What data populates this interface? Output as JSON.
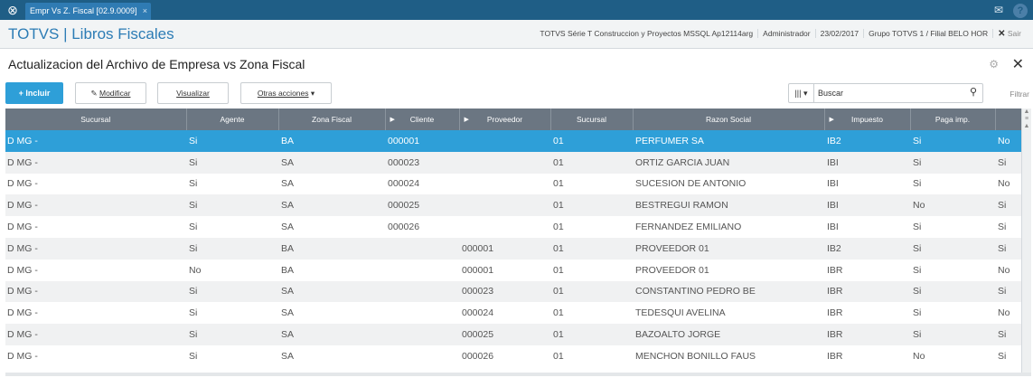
{
  "window": {
    "tab_label": "Empr Vs Z. Fiscal [02.9.0009]",
    "tab_close": "×"
  },
  "app": {
    "title": "TOTVS | Libros Fiscales",
    "environment": "TOTVS Série T Construccion y Proyectos MSSQL Ap12114arg",
    "user": "Administrador",
    "date": "23/02/2017",
    "branch": "Grupo TOTVS 1 / Filial BELO HOR",
    "exit_label": "Sair"
  },
  "page": {
    "title": "Actualizacion del Archivo de Empresa vs Zona Fiscal"
  },
  "toolbar": {
    "incluir": "+ Incluir",
    "modificar": "Modificar",
    "visualizar": "Visualizar",
    "otras": "Otras acciones",
    "search_placeholder": "Buscar",
    "filtrar": "Filtrar"
  },
  "icons": {
    "app": "totvs-logo-icon",
    "mail": "mail-icon",
    "help": "help-icon",
    "settings": "gear-icon",
    "close": "close-icon",
    "search": "search-icon",
    "columns": "columns-icon"
  },
  "colors": {
    "topbar": "#1f5e86",
    "accent": "#2e9fd8",
    "header": "#6b7682"
  },
  "grid": {
    "columns": [
      "Sucursal",
      "Agente",
      "Zona Fiscal",
      "Cliente",
      "Proveedor",
      "Sucursal",
      "Razon Social",
      "Impuesto",
      "Paga imp.",
      ""
    ],
    "rows": [
      [
        "D MG  -",
        "Si",
        "BA",
        "000001",
        "",
        "01",
        "PERFUMER SA",
        "IB2",
        "Si",
        "No"
      ],
      [
        "D MG  -",
        "Si",
        "SA",
        "000023",
        "",
        "01",
        "ORTIZ GARCIA JUAN",
        "IBI",
        "Si",
        "Si"
      ],
      [
        "D MG  -",
        "Si",
        "SA",
        "000024",
        "",
        "01",
        "SUCESION DE ANTONIO",
        "IBI",
        "Si",
        "No"
      ],
      [
        "D MG  -",
        "Si",
        "SA",
        "000025",
        "",
        "01",
        "BESTREGUI RAMON",
        "IBI",
        "No",
        "Si"
      ],
      [
        "D MG  -",
        "Si",
        "SA",
        "000026",
        "",
        "01",
        "FERNANDEZ EMILIANO",
        "IBI",
        "Si",
        "Si"
      ],
      [
        "D MG  -",
        "Si",
        "BA",
        "",
        "000001",
        "01",
        "PROVEEDOR 01",
        "IB2",
        "Si",
        "Si"
      ],
      [
        "D MG  -",
        "No",
        "BA",
        "",
        "000001",
        "01",
        "PROVEEDOR 01",
        "IBR",
        "Si",
        "No"
      ],
      [
        "D MG  -",
        "Si",
        "SA",
        "",
        "000023",
        "01",
        "CONSTANTINO PEDRO BE",
        "IBR",
        "Si",
        "Si"
      ],
      [
        "D MG  -",
        "Si",
        "SA",
        "",
        "000024",
        "01",
        "TEDESQUI AVELINA",
        "IBR",
        "Si",
        "No"
      ],
      [
        "D MG  -",
        "Si",
        "SA",
        "",
        "000025",
        "01",
        "BAZOALTO JORGE",
        "IBR",
        "Si",
        "Si"
      ],
      [
        "D MG  -",
        "Si",
        "SA",
        "",
        "000026",
        "01",
        "MENCHON BONILLO FAUS",
        "IBR",
        "No",
        "Si"
      ]
    ]
  }
}
